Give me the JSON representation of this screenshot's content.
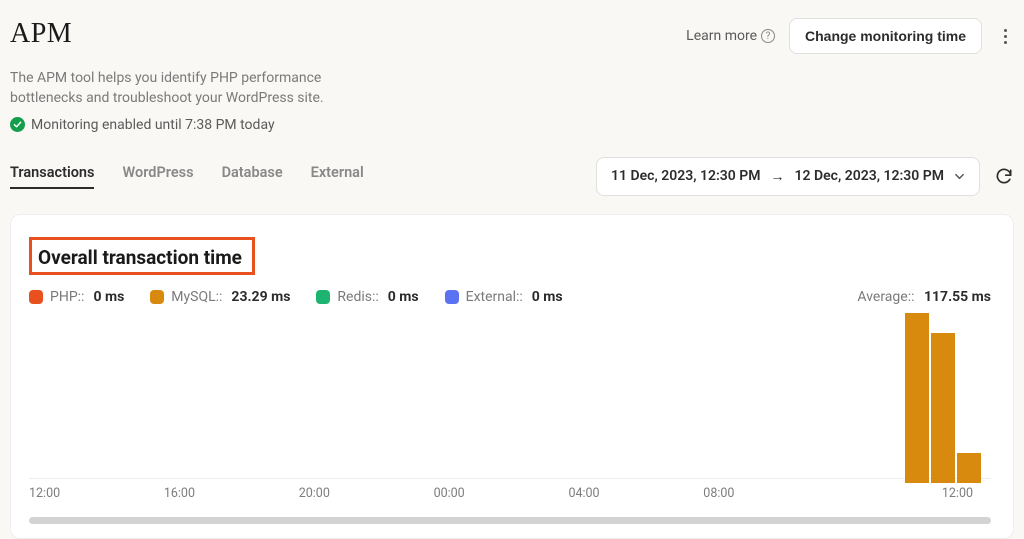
{
  "header": {
    "title": "APM",
    "learn_more": "Learn more",
    "change_time_button": "Change monitoring time"
  },
  "subtitle": "The APM tool helps you identify PHP performance bottlenecks and troubleshoot your WordPress site.",
  "status": "Monitoring enabled until 7:38 PM today",
  "tabs": [
    {
      "label": "Transactions",
      "active": true
    },
    {
      "label": "WordPress",
      "active": false
    },
    {
      "label": "Database",
      "active": false
    },
    {
      "label": "External",
      "active": false
    }
  ],
  "date_range": {
    "from": "11 Dec, 2023, 12:30 PM",
    "to": "12 Dec, 2023, 12:30 PM"
  },
  "card": {
    "title": "Overall transaction time",
    "legend": [
      {
        "label": "PHP::",
        "value": "0 ms",
        "color": "#e8501e"
      },
      {
        "label": "MySQL::",
        "value": "23.29 ms",
        "color": "#d88a0f"
      },
      {
        "label": "Redis::",
        "value": "0 ms",
        "color": "#1db471"
      },
      {
        "label": "External::",
        "value": "0 ms",
        "color": "#5b72f2"
      }
    ],
    "average_label": "Average::",
    "average_value": "117.55 ms"
  },
  "chart_data": {
    "type": "bar",
    "title": "Overall transaction time",
    "xlabel": "",
    "ylabel": "ms",
    "categories": [
      "12:00",
      "16:00",
      "20:00",
      "00:00",
      "04:00",
      "08:00",
      "12:00"
    ],
    "ylim": [
      0,
      180
    ],
    "series": [
      {
        "name": "PHP",
        "values": [
          0,
          0,
          0,
          0,
          0,
          0,
          0
        ]
      },
      {
        "name": "MySQL",
        "values": [
          0,
          0,
          0,
          0,
          0,
          0,
          23.29
        ]
      },
      {
        "name": "Redis",
        "values": [
          0,
          0,
          0,
          0,
          0,
          0,
          0
        ]
      },
      {
        "name": "External",
        "values": [
          0,
          0,
          0,
          0,
          0,
          0,
          0
        ]
      }
    ],
    "visible_bars": [
      170,
      150,
      30
    ]
  },
  "x_ticks": [
    "12:00",
    "16:00",
    "20:00",
    "00:00",
    "04:00",
    "08:00",
    "12:00"
  ]
}
